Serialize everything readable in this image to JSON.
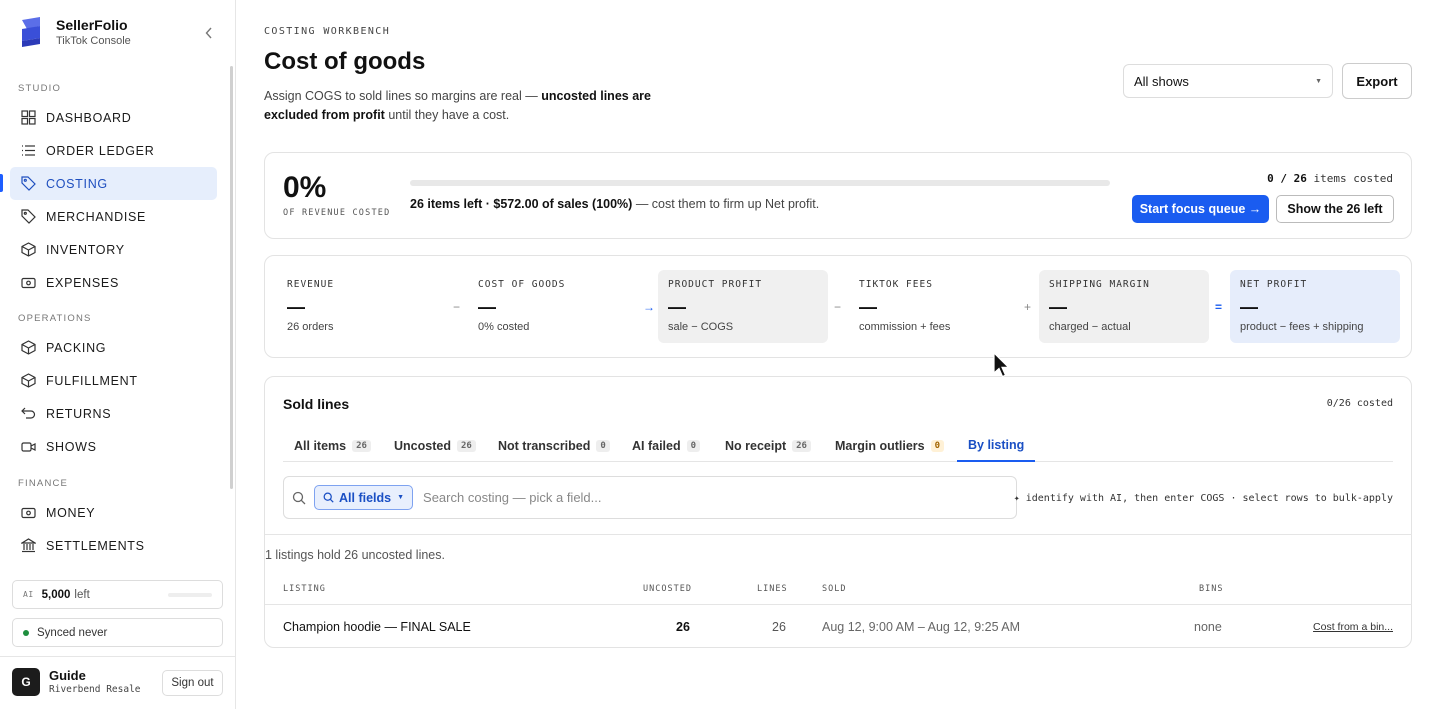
{
  "sidebar": {
    "brand": {
      "name": "SellerFolio",
      "sub": "TikTok Console"
    },
    "sections": {
      "studio": "STUDIO",
      "operations": "OPERATIONS",
      "finance": "FINANCE"
    },
    "items": [
      {
        "label": "DASHBOARD",
        "icon": "grid-icon"
      },
      {
        "label": "ORDER LEDGER",
        "icon": "list-icon"
      },
      {
        "label": "COSTING",
        "icon": "tag-icon",
        "active": true
      },
      {
        "label": "MERCHANDISE",
        "icon": "tag-icon"
      },
      {
        "label": "INVENTORY",
        "icon": "box-icon"
      },
      {
        "label": "EXPENSES",
        "icon": "banknote-icon"
      },
      {
        "label": "PACKING",
        "icon": "box-icon"
      },
      {
        "label": "FULFILLMENT",
        "icon": "box-icon"
      },
      {
        "label": "RETURNS",
        "icon": "undo-icon"
      },
      {
        "label": "SHOWS",
        "icon": "video-icon"
      },
      {
        "label": "MONEY",
        "icon": "banknote-icon"
      },
      {
        "label": "SETTLEMENTS",
        "icon": "bank-icon"
      }
    ],
    "ai": {
      "tag": "AI",
      "amount": "5,000",
      "suffix": "left"
    },
    "sync": "Synced never",
    "user": {
      "initial": "G",
      "name": "Guide",
      "org": "Riverbend Resale",
      "signout": "Sign out"
    }
  },
  "header": {
    "eyebrow": "COSTING WORKBENCH",
    "title": "Cost of goods",
    "desc_pre": "Assign COGS to sold lines so margins are real — ",
    "desc_bold": "uncosted lines are excluded from profit",
    "desc_post": " until they have a cost.",
    "shows_select": "All shows",
    "export": "Export"
  },
  "progress": {
    "percent": "0%",
    "percent_label": "OF REVENUE COSTED",
    "fraction": 0,
    "text_bold": "26 items left · $572.00 of sales (100%)",
    "text_rest": " — cost them to firm up Net profit.",
    "count_bold": "0 / 26",
    "count_rest": " items costed",
    "primary_btn": "Start focus queue →",
    "secondary_btn": "Show the 26 left"
  },
  "metrics": [
    {
      "label": "REVENUE",
      "value": "—",
      "sub": "26 orders"
    },
    {
      "label": "COST OF GOODS",
      "value": "—",
      "sub": "0% costed"
    },
    {
      "label": "PRODUCT PROFIT",
      "value": "—",
      "sub": "sale − COGS"
    },
    {
      "label": "TIKTOK FEES",
      "value": "—",
      "sub": "commission + fees"
    },
    {
      "label": "SHIPPING MARGIN",
      "value": "—",
      "sub": "charged − actual"
    },
    {
      "label": "NET PROFIT",
      "value": "—",
      "sub": "product − fees + shipping"
    }
  ],
  "operators": [
    "−",
    "→",
    "−",
    "+",
    "="
  ],
  "sold": {
    "title": "Sold lines",
    "count": "0/26 costed",
    "tabs": [
      {
        "label": "All items",
        "badge": "26"
      },
      {
        "label": "Uncosted",
        "badge": "26"
      },
      {
        "label": "Not transcribed",
        "badge": "0"
      },
      {
        "label": "AI failed",
        "badge": "0"
      },
      {
        "label": "No receipt",
        "badge": "26"
      },
      {
        "label": "Margin outliers",
        "badge": "0"
      },
      {
        "label": "By listing",
        "badge": ""
      }
    ],
    "field_chip": "All fields",
    "search_placeholder": "Search costing — pick a field...",
    "hint": "✦ identify with AI, then enter COGS · select rows to bulk-apply",
    "summary": "1 listings hold 26 uncosted lines.",
    "columns": [
      "LISTING",
      "UNCOSTED",
      "LINES",
      "SOLD",
      "BINS"
    ],
    "row": {
      "listing": "Champion hoodie — FINAL SALE",
      "uncosted": "26",
      "lines": "26",
      "sold": "Aug 12, 9:00 AM – Aug 12, 9:25 AM",
      "bins": "none",
      "action": "Cost from a bin..."
    }
  },
  "colors": {
    "accent": "#1a5cf0",
    "active_bg": "#e6eefc",
    "net_bg": "#e6edfb"
  }
}
